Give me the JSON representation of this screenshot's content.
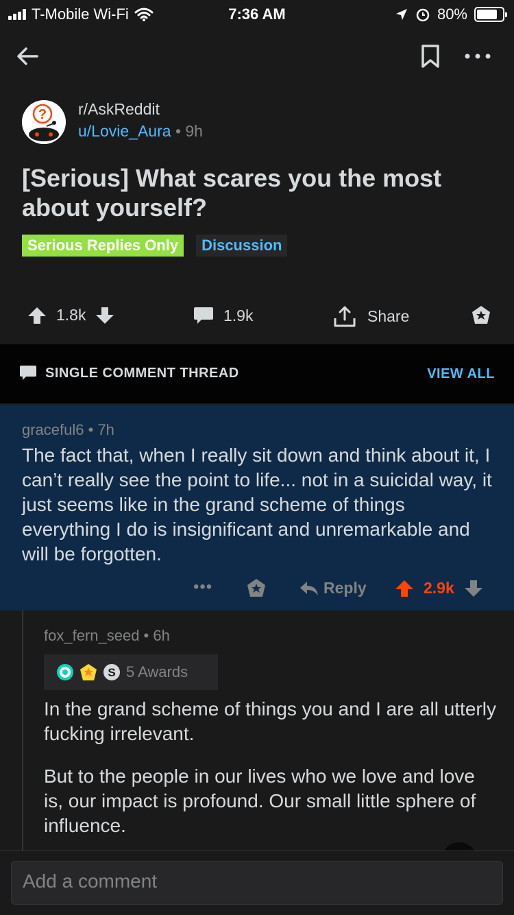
{
  "status_bar": {
    "carrier": "T-Mobile Wi-Fi",
    "time": "7:36 AM",
    "battery": "80%",
    "battery_level": 0.8
  },
  "navbar": {
    "icons": [
      "back-arrow-icon",
      "bookmark-icon",
      "more-options-icon"
    ]
  },
  "post": {
    "subreddit": "r/AskReddit",
    "author": "u/Lovie_Aura",
    "separator": "•",
    "age": "9h",
    "title": "[Serious] What scares you the most about yourself?",
    "flairs": [
      {
        "label": "Serious Replies Only",
        "bg": "#94e044",
        "color": "#ffffff"
      },
      {
        "label": "Discussion",
        "bg": "#272729",
        "color": "#4fbcff"
      }
    ],
    "votes": "1.8k",
    "comments": "1.9k",
    "share_label": "Share"
  },
  "thread_bar": {
    "label": "SINGLE COMMENT THREAD",
    "view_all": "VIEW ALL"
  },
  "focused_comment": {
    "author": "graceful6",
    "age": "7h",
    "meta": "graceful6 • 7h",
    "body": "The fact that, when I really sit down and think about it, I can’t really see the point to life... not in a suicidal way, it just seems like in the grand scheme of things everything I do is insignificant and unremarkable and will be forgotten.",
    "more": "•••",
    "reply_label": "Reply",
    "score": "2.9k",
    "upvoted": true
  },
  "reply_comment": {
    "meta": "fox_fern_seed • 6h",
    "awards_label": "5 Awards",
    "paragraph1": "In the grand scheme of things you and I are all utterly fucking irrelevant.",
    "paragraph2": "But to the people in our lives who we love and love is, our impact is profound. Our small little sphere of influence."
  },
  "comment_input": {
    "placeholder": "Add a comment"
  },
  "colors": {
    "background": "#1a1a1b",
    "accent_blue": "#4fbcff",
    "upvote_orange": "#ff4500",
    "highlight_bg": "#0f2a48"
  }
}
